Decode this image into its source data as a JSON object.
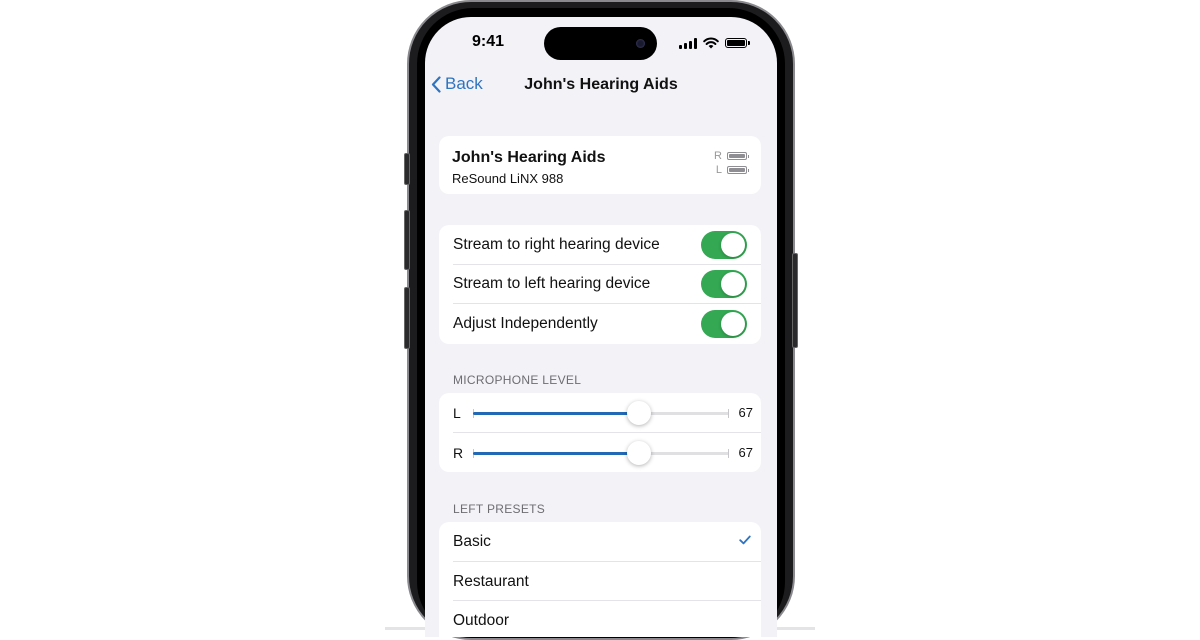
{
  "status_bar": {
    "time": "9:41",
    "signal_icon": "cellular-signal-icon",
    "wifi_icon": "wifi-icon",
    "battery_icon": "battery-icon"
  },
  "nav": {
    "back_label": "Back",
    "title": "John's Hearing Aids"
  },
  "device": {
    "name": "John's Hearing Aids",
    "model": "ReSound LiNX 988",
    "batteries": [
      {
        "side": "R",
        "level": 1.0
      },
      {
        "side": "L",
        "level": 1.0
      }
    ]
  },
  "toggles": [
    {
      "label": "Stream to right hearing device",
      "on": true
    },
    {
      "label": "Stream to left hearing device",
      "on": true
    },
    {
      "label": "Adjust Independently",
      "on": true
    }
  ],
  "microphone": {
    "header": "MICROPHONE LEVEL",
    "sliders": [
      {
        "side": "L",
        "value": "67",
        "fraction": 0.65
      },
      {
        "side": "R",
        "value": "67",
        "fraction": 0.65
      }
    ]
  },
  "presets": {
    "header": "LEFT PRESETS",
    "items": [
      {
        "label": "Basic",
        "selected": true
      },
      {
        "label": "Restaurant",
        "selected": false
      },
      {
        "label": "Outdoor",
        "selected": false
      }
    ]
  },
  "colors": {
    "accent": "#2f74c0",
    "toggle_on": "#34a853",
    "slider_fill": "#2169b5",
    "background": "#f2f2f7"
  }
}
